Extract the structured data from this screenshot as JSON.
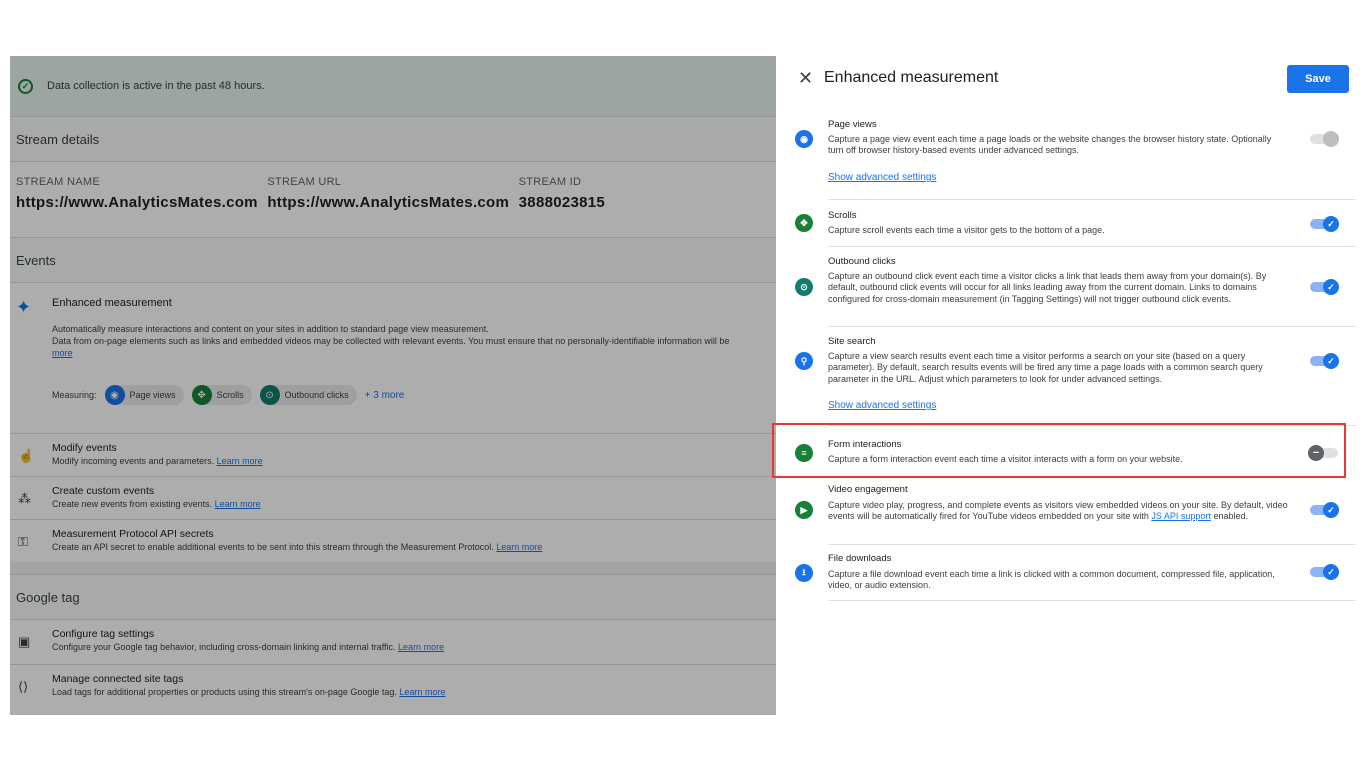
{
  "banner": {
    "text": "Data collection is active in the past 48 hours."
  },
  "stream_details": {
    "heading": "Stream details",
    "fields": [
      {
        "label": "STREAM NAME",
        "value": "https://www.AnalyticsMates.com"
      },
      {
        "label": "STREAM URL",
        "value": "https://www.AnalyticsMates.com"
      },
      {
        "label": "STREAM ID",
        "value": "3888023815"
      }
    ]
  },
  "events": {
    "heading": "Events",
    "enhanced": {
      "title": "Enhanced measurement",
      "desc1": "Automatically measure interactions and content on your sites in addition to standard page view measurement.",
      "desc2": "Data from on-page elements such as links and embedded videos may be collected with relevant events. You must ensure that no personally-identifiable information will be",
      "more": "more",
      "measuring_label": "Measuring:",
      "chips": [
        "Page views",
        "Scrolls",
        "Outbound clicks"
      ],
      "more_chips": "+ 3 more"
    },
    "rows": [
      {
        "title": "Modify events",
        "desc": "Modify incoming events and parameters.",
        "link": "Learn more"
      },
      {
        "title": "Create custom events",
        "desc": "Create new events from existing events.",
        "link": "Learn more"
      },
      {
        "title": "Measurement Protocol API secrets",
        "desc": "Create an API secret to enable additional events to be sent into this stream through the Measurement Protocol.",
        "link": "Learn more"
      }
    ]
  },
  "google_tag": {
    "heading": "Google tag",
    "rows": [
      {
        "title": "Configure tag settings",
        "desc": "Configure your Google tag behavior, including cross-domain linking and internal traffic.",
        "link": "Learn more"
      },
      {
        "title": "Manage connected site tags",
        "desc": "Load tags for additional properties or products using this stream's on-page Google tag.",
        "link": "Learn more"
      }
    ]
  },
  "panel": {
    "title": "Enhanced measurement",
    "save_label": "Save",
    "items": [
      {
        "title": "Page views",
        "desc": "Capture a page view event each time a page loads or the website changes the browser history state. Optionally turn off browser history-based events under advanced settings.",
        "advanced": "Show advanced settings",
        "icon": "eye-icon",
        "toggle": "on-disabled"
      },
      {
        "title": "Scrolls",
        "desc": "Capture scroll events each time a visitor gets to the bottom of a page.",
        "icon": "scroll-icon",
        "toggle": "on"
      },
      {
        "title": "Outbound clicks",
        "desc": "Capture an outbound click event each time a visitor clicks a link that leads them away from your domain(s). By default, outbound click events will occur for all links leading away from the current domain. Links to domains configured for cross-domain measurement (in Tagging Settings) will not trigger outbound click events.",
        "icon": "mouse-icon",
        "toggle": "on"
      },
      {
        "title": "Site search",
        "desc": "Capture a view search results event each time a visitor performs a search on your site (based on a query parameter). By default, search results events will be fired any time a page loads with a common search query parameter in the URL. Adjust which parameters to look for under advanced settings.",
        "advanced": "Show advanced settings",
        "icon": "search-icon",
        "toggle": "on"
      },
      {
        "title": "Form interactions",
        "desc": "Capture a form interaction event each time a visitor interacts with a form on your website.",
        "icon": "form-icon",
        "toggle": "off"
      },
      {
        "title": "Video engagement",
        "desc_pre": "Capture video play, progress, and complete events as visitors view embedded videos on your site. By default, video events will be automatically fired for YouTube videos embedded on your site with",
        "desc_link": "JS API support",
        "desc_post": "enabled.",
        "icon": "play-icon",
        "toggle": "on"
      },
      {
        "title": "File downloads",
        "desc": "Capture a file download event each time a link is clicked with a common document, compressed file, application, video, or audio extension.",
        "icon": "download-icon",
        "toggle": "on"
      }
    ]
  },
  "colors": {
    "accent": "#1a73e8",
    "green": "#188038",
    "highlight": "#e53935"
  }
}
